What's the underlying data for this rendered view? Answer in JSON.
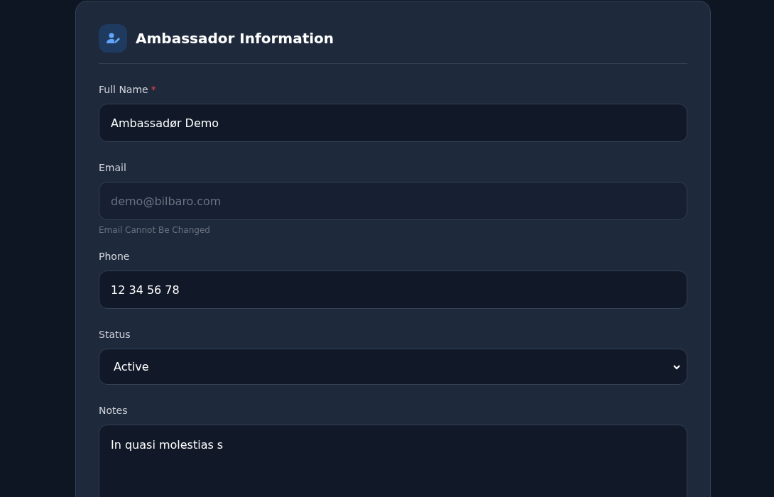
{
  "card": {
    "title": "Ambassador Information"
  },
  "fields": [
    {
      "kind": "text",
      "label": "Full Name",
      "required_mark": "*",
      "value": "Ambassadør Demo",
      "disabled": false
    },
    {
      "kind": "text",
      "label": "Email",
      "value": "demo@bilbaro.com",
      "disabled": true,
      "hint": "Email Cannot Be Changed"
    },
    {
      "kind": "text",
      "label": "Phone",
      "value": "12 34 56 78",
      "disabled": false
    },
    {
      "kind": "select",
      "label": "Status",
      "value": "Active",
      "disabled": false
    },
    {
      "kind": "textarea",
      "label": "Notes",
      "value": "In quasi molestias s",
      "disabled": false
    }
  ]
}
